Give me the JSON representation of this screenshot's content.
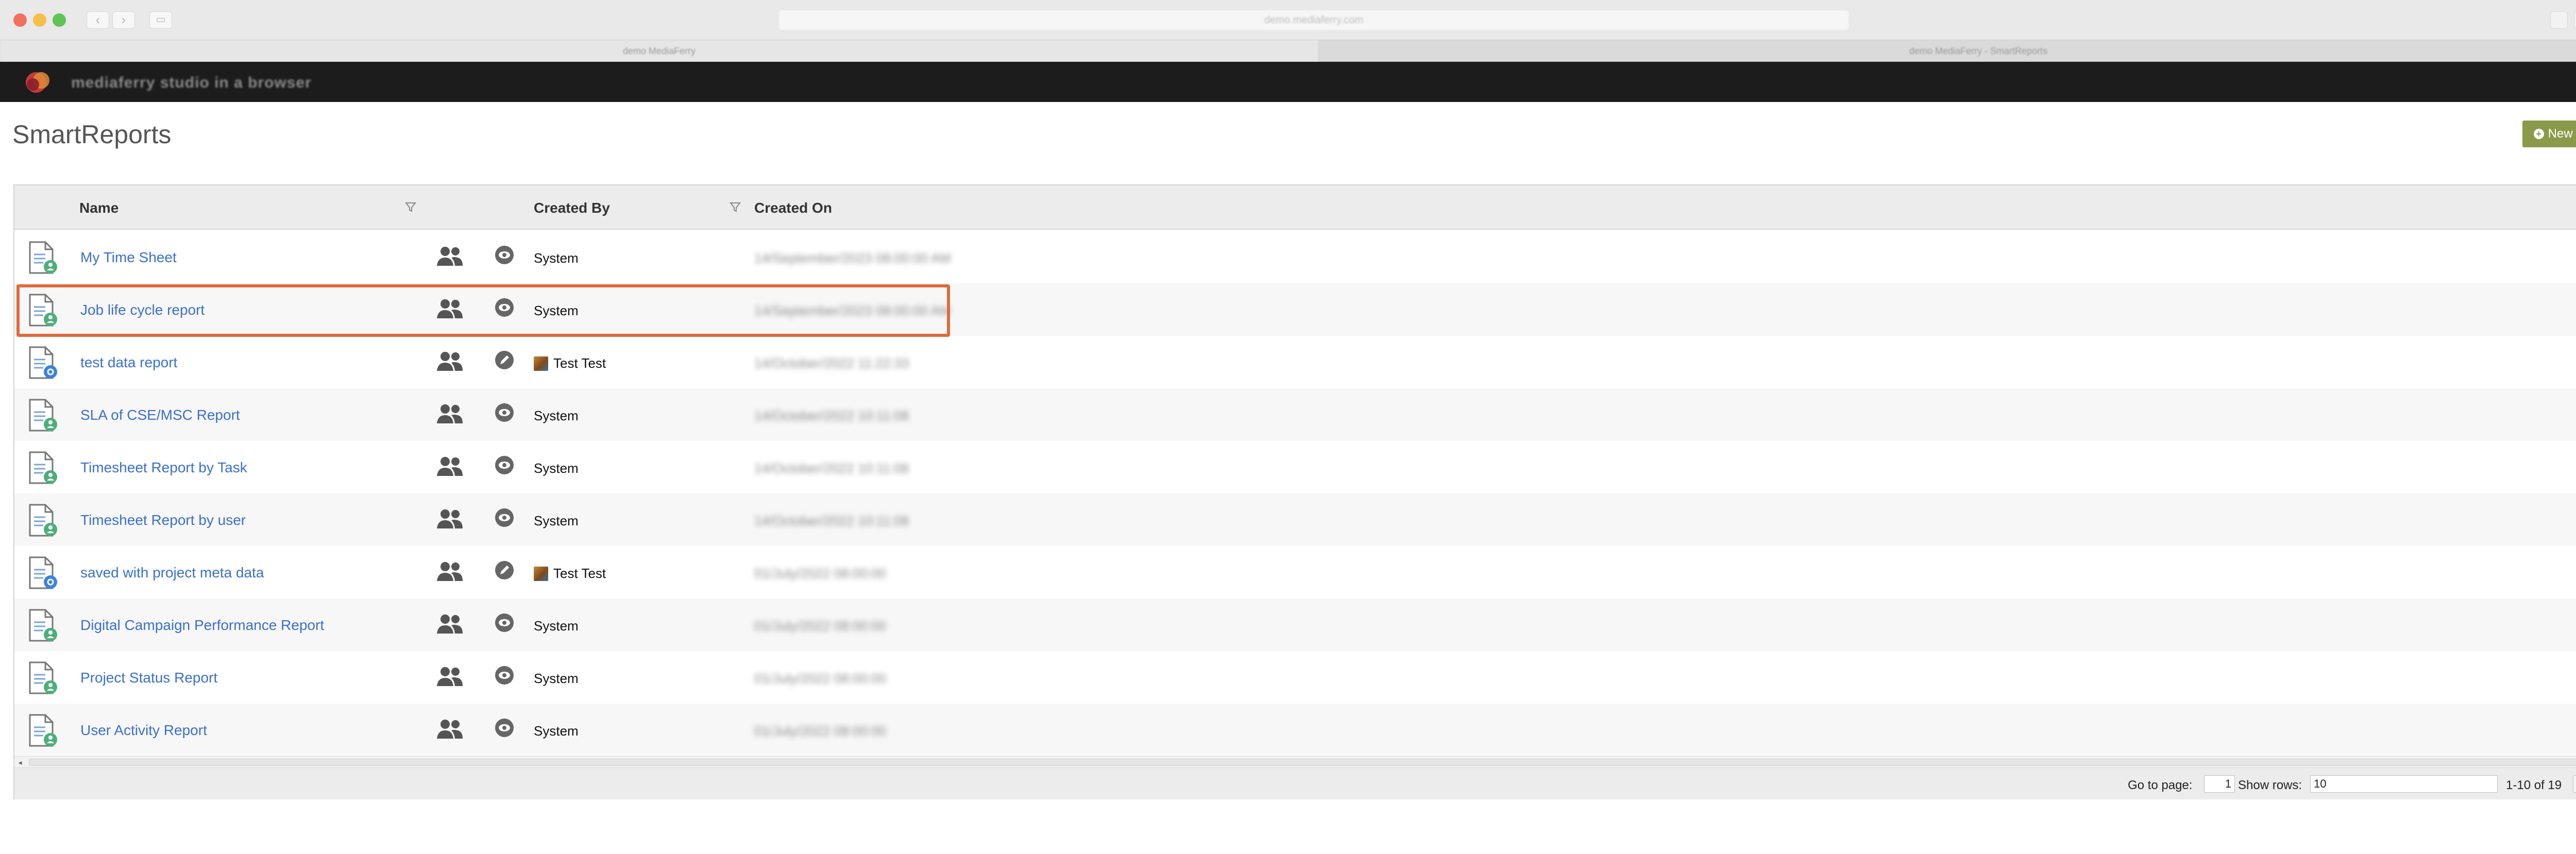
{
  "browser": {
    "url": "demo.mediaferry.com",
    "tabs": [
      "demo MediaFerry",
      "demo MediaFerry - SmartReports"
    ]
  },
  "app": {
    "logo_text": "mediaferry studio in a browser"
  },
  "page": {
    "title": "SmartReports",
    "new_report_label": "New Report"
  },
  "table": {
    "columns": [
      "Name",
      "Created By",
      "Created On"
    ],
    "rows": [
      {
        "name": "My Time Sheet",
        "created_by": "System",
        "created_on": "14/September/2023 08:00:00 AM",
        "icon": "doc-green-user",
        "action": "view"
      },
      {
        "name": "Job life cycle report",
        "created_by": "System",
        "created_on": "14/September/2023 08:00:00 AM",
        "icon": "doc-green-user",
        "action": "view"
      },
      {
        "name": "test data report",
        "created_by": "Test Test",
        "created_on": "14/October/2022 11:22:33",
        "icon": "doc-blue-gear",
        "action": "edit"
      },
      {
        "name": "SLA of CSE/MSC Report",
        "created_by": "System",
        "created_on": "14/October/2022 10:11:08",
        "icon": "doc-green-user",
        "action": "view"
      },
      {
        "name": "Timesheet Report by Task",
        "created_by": "System",
        "created_on": "14/October/2022 10:11:08",
        "icon": "doc-green-user",
        "action": "view"
      },
      {
        "name": "Timesheet Report by user",
        "created_by": "System",
        "created_on": "14/October/2022 10:11:08",
        "icon": "doc-green-user",
        "action": "view"
      },
      {
        "name": "saved with project meta data",
        "created_by": "Test Test",
        "created_on": "01/July/2022 08:00:00",
        "icon": "doc-blue-gear",
        "action": "edit"
      },
      {
        "name": "Digital Campaign Performance Report",
        "created_by": "System",
        "created_on": "01/July/2022 08:00:00",
        "icon": "doc-green-user",
        "action": "view"
      },
      {
        "name": "Project Status Report",
        "created_by": "System",
        "created_on": "01/July/2022 08:00:00",
        "icon": "doc-green-user",
        "action": "view"
      },
      {
        "name": "User Activity Report",
        "created_by": "System",
        "created_on": "01/July/2022 08:00:00",
        "icon": "doc-green-user",
        "action": "view"
      }
    ]
  },
  "pager": {
    "go_to_page_label": "Go to page:",
    "page_value": "1",
    "show_rows_label": "Show rows:",
    "rows_value": "10",
    "range_text": "1-10 of 19"
  },
  "colors": {
    "accent_green": "#8a9a4a",
    "link_blue": "#3a6fd0",
    "highlight": "#e06a3c"
  }
}
